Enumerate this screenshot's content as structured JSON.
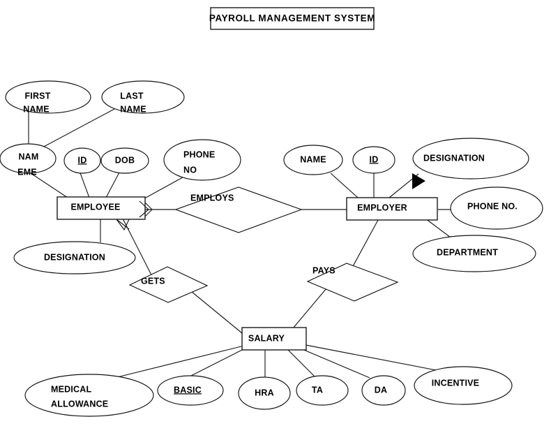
{
  "title_box": {
    "label": "PAYROLL  MANAGEMENT SYSTEM"
  },
  "entities": [
    {
      "id": "employee",
      "label": "EMPLOYEE"
    },
    {
      "id": "employer",
      "label": "EMPLOYER"
    },
    {
      "id": "salary",
      "label": "SALARY"
    }
  ],
  "relationships": [
    {
      "id": "employs",
      "label": "EMPLOYS"
    },
    {
      "id": "gets",
      "label": "GETS"
    },
    {
      "id": "pays",
      "label": "PAYS"
    }
  ],
  "employee_attributes": [
    {
      "id": "first-name",
      "label": "FIRST NAME",
      "line1": "FIRST",
      "line2": "NAME",
      "key": false
    },
    {
      "id": "last-name",
      "label": "LAST NAME",
      "line1": "LAST",
      "line2": "NAME",
      "key": false
    },
    {
      "id": "name",
      "label": "NAME",
      "line1": "NAM",
      "line2": "EME",
      "key": false
    },
    {
      "id": "id",
      "label": "ID",
      "line1": "ID",
      "line2": "",
      "key": true
    },
    {
      "id": "dob",
      "label": "DOB",
      "line1": "DOB",
      "line2": "",
      "key": false
    },
    {
      "id": "phone-no",
      "label": "PHONE NO",
      "line1": "PHONE",
      "line2": "NO",
      "key": false
    },
    {
      "id": "designation",
      "label": "DESIGNATION",
      "line1": "DESIGNATION",
      "line2": "",
      "key": false
    }
  ],
  "employer_attributes": [
    {
      "id": "name",
      "label": "NAME",
      "line1": "NAME",
      "line2": "",
      "key": false
    },
    {
      "id": "id",
      "label": "ID",
      "line1": "ID",
      "line2": "",
      "key": true
    },
    {
      "id": "designation",
      "label": "DESIGNATION",
      "line1": "DESIGNATION",
      "line2": "",
      "key": false
    },
    {
      "id": "phone-no",
      "label": "PHONE NO.",
      "line1": "PHONE NO.",
      "line2": "",
      "key": false
    },
    {
      "id": "department",
      "label": "DEPARTMENT",
      "line1": "DEPARTMENT",
      "line2": "",
      "key": false
    }
  ],
  "salary_attributes": [
    {
      "id": "medical-allowance",
      "label": "MEDICAL ALLOWANCE",
      "line1": "MEDICAL",
      "line2": "ALLOWANCE",
      "key": false
    },
    {
      "id": "basic",
      "label": "BASIC",
      "line1": "BASIC",
      "line2": "",
      "key": true
    },
    {
      "id": "hra",
      "label": "HRA",
      "line1": "HRA",
      "line2": "",
      "key": false
    },
    {
      "id": "ta",
      "label": "TA",
      "line1": "TA",
      "line2": "",
      "key": false
    },
    {
      "id": "da",
      "label": "DA",
      "line1": "DA",
      "line2": "",
      "key": false
    },
    {
      "id": "incentive",
      "label": "INCENTIVE",
      "line1": "INCENTIVE",
      "line2": "",
      "key": false
    }
  ],
  "colors": {
    "background": "#ffffff",
    "stroke": "#111111",
    "text": "#000000",
    "cursor": "#000000"
  }
}
